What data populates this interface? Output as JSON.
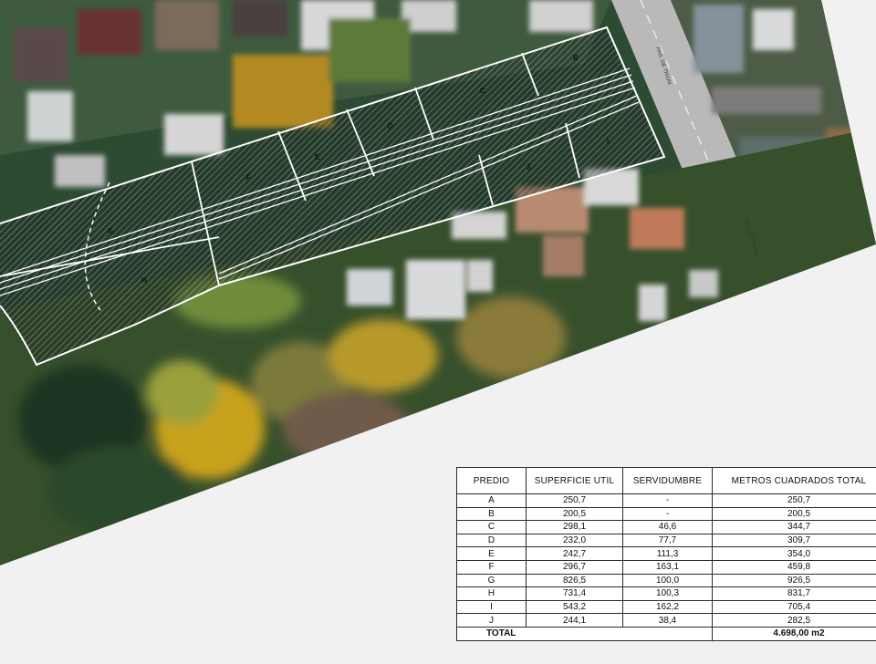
{
  "map": {
    "lots": [
      {
        "id": "A",
        "label": "A"
      },
      {
        "id": "B",
        "label": "B"
      },
      {
        "id": "C",
        "label": "C"
      },
      {
        "id": "D",
        "label": "D"
      },
      {
        "id": "E",
        "label": "E"
      },
      {
        "id": "F",
        "label": "F"
      },
      {
        "id": "G",
        "label": "G"
      },
      {
        "id": "H",
        "label": "H"
      },
      {
        "id": "I",
        "label": "I"
      },
      {
        "id": "J",
        "label": "J"
      }
    ],
    "street_labels": [
      "PAS. DE TRIUN",
      "PAS. DE TRIUN"
    ],
    "colors": {
      "vegetation_dark": "#1f3a2a",
      "vegetation_green": "#4f7a3a",
      "vegetation_autumn": "#c9a21f",
      "road": "#bdbdbd",
      "hatch": "#ffffff",
      "paper": "#f1f1f1"
    }
  },
  "table": {
    "headers": [
      "PREDIO",
      "SUPERFICIE UTIL",
      "SERVIDUMBRE",
      "METROS CUADRADOS TOTAL"
    ],
    "rows": [
      [
        "A",
        "250,7",
        "-",
        "250,7"
      ],
      [
        "B",
        "200,5",
        "-",
        "200,5"
      ],
      [
        "C",
        "298,1",
        "46,6",
        "344,7"
      ],
      [
        "D",
        "232,0",
        "77,7",
        "309,7"
      ],
      [
        "E",
        "242,7",
        "111,3",
        "354,0"
      ],
      [
        "F",
        "296,7",
        "163,1",
        "459,8"
      ],
      [
        "G",
        "826,5",
        "100,0",
        "926,5"
      ],
      [
        "H",
        "731,4",
        "100,3",
        "831,7"
      ],
      [
        "I",
        "543,2",
        "162,2",
        "705,4"
      ],
      [
        "J",
        "244,1",
        "38,4",
        "282,5"
      ]
    ],
    "total_label": "TOTAL",
    "total_value": "4.698,00 m2"
  }
}
